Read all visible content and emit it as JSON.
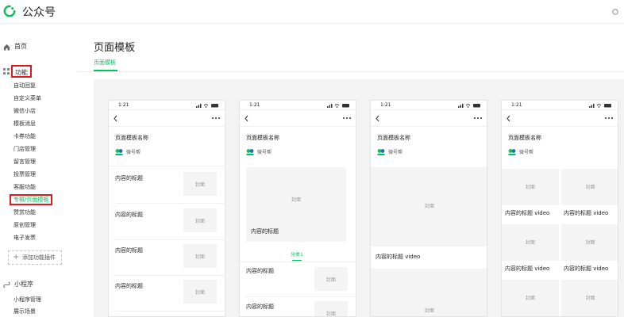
{
  "app": {
    "title": "公众号"
  },
  "colors": {
    "brand": "#07c160",
    "highlight_box": "#e0191c"
  },
  "sidebar": {
    "home": {
      "label": "首页",
      "icon": "home-icon"
    },
    "features": {
      "label": "功能",
      "icon": "grid-icon"
    },
    "feature_items": [
      {
        "label": "自动回复"
      },
      {
        "label": "自定义菜单"
      },
      {
        "label": "微信小店"
      },
      {
        "label": "模板消息"
      },
      {
        "label": "卡券功能"
      },
      {
        "label": "门店管理"
      },
      {
        "label": "留言管理"
      },
      {
        "label": "投票管理"
      },
      {
        "label": "客服功能"
      },
      {
        "label": "专辑/页面模板"
      },
      {
        "label": "赞赏功能"
      },
      {
        "label": "原创管理"
      },
      {
        "label": "电子发票"
      }
    ],
    "add_plugin": {
      "label": "添加功能插件"
    },
    "mini_program": {
      "label": "小程序",
      "icon": "mini-program-icon"
    },
    "mini_items": [
      {
        "label": "小程序管理"
      },
      {
        "label": "展示场景"
      }
    ]
  },
  "main": {
    "page_title": "页面模板",
    "tab": "页面模板"
  },
  "phone": {
    "time": "1:21",
    "template_name": "页面模板名称",
    "brand_name": "微号帮",
    "item_title": "内容的标题",
    "cover": "封面",
    "category": "分类1",
    "video_title": "内容的标题 video"
  }
}
